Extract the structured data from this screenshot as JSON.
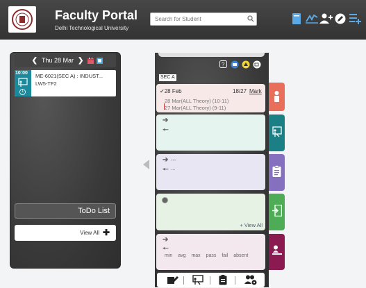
{
  "header": {
    "title": "Faculty Portal",
    "subtitle": "Delhi Technological University",
    "search_placeholder": "Search for Student",
    "icons": [
      "book-icon",
      "signature-icon",
      "add-user-icon",
      "edit-icon",
      "list-add-icon"
    ]
  },
  "left_panel": {
    "date": "Thu 28 Mar",
    "lecture": {
      "time": "10:00",
      "badge": "1",
      "title": "ME-6021(SEC A) : INDUST...",
      "location": "LW5-TF2"
    },
    "todo_label": "ToDo List",
    "view_all_label": "View All",
    "view_all_symbol": "✚"
  },
  "mid_panel": {
    "section": "SEC A",
    "attendance": {
      "check": "✔",
      "date": "28 Feb",
      "count": "18/27",
      "mark_label": "Mark",
      "lines": [
        "28 Mar(ALL Theory) (10-11)",
        "27 Mar(ALL Theory) (9-11)"
      ]
    },
    "card_b_text": "---",
    "card_b_text2": "...",
    "card_c_link": "+ View All",
    "card_d_stats": "min avg max pass fail absent"
  },
  "colors": {
    "header_bg": "#3d3d3d",
    "teal": "#1b7f86",
    "coral": "#e86f5c",
    "purple": "#8470bf",
    "green": "#4eab56",
    "maroon": "#8b1a50"
  }
}
